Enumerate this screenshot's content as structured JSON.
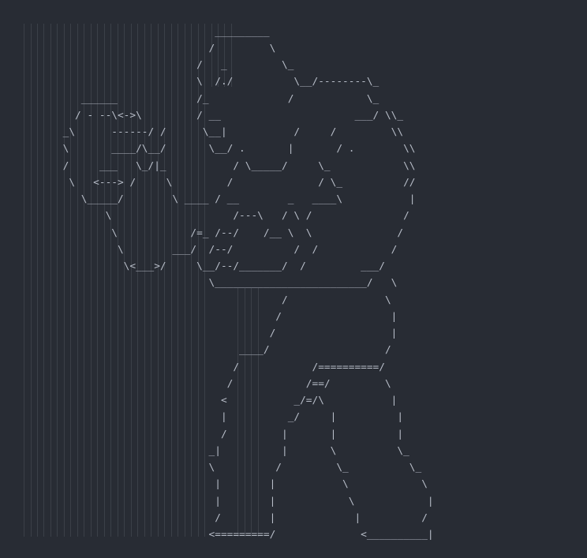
{
  "editor": {
    "line_numbers": [
      "1",
      "2",
      "3",
      "4",
      "5",
      "6",
      "7",
      "8",
      "9",
      "0",
      "1",
      "2",
      "3",
      "4",
      "5",
      "6",
      "7",
      "8",
      "9",
      "0",
      "1",
      "2",
      "3",
      "4",
      "5",
      "6",
      "7",
      "8",
      "9",
      "0",
      "1",
      "2",
      "3",
      "4"
    ],
    "lines": [
      "",
      "",
      "                                 _________",
      "                                /         \\",
      "                              /   _         \\_",
      "                              \\  /./          \\__/--------\\_",
      "           ______             /_             /            \\_",
      "          / - --\\<->\\         / __                      ___/ \\\\_",
      "        _\\      ------/ /      \\__|           /     /         \\\\",
      "        \\       ____/\\__/       \\__/ .       |       / .        \\\\",
      "        /     ___   \\_/|_           / \\_____/     \\_            \\\\",
      "         \\   <---> /     \\         /              / \\_          //",
      "           \\_____/        \\ ____ / __        _   ____\\           |",
      "               \\                    /---\\   / \\ /               /",
      "                \\            /=_ /--/    /__ \\  \\              /",
      "                 \\        ___/  /--/          /  /            /",
      "                  \\<___>/     \\__/--/_______/  /         ___/",
      "                                \\_________________________/   \\",
      "                                            /                \\",
      "                                           /                  |",
      "                                          /                   |",
      "                                     ____/                   /",
      "                                    /            /==========/",
      "                                   /            /==/         \\",
      "                                  <           _/=/\\           |",
      "                                  |          _/     |          |",
      "                                  /         |       |          |",
      "                                _|          |       \\          \\_",
      "                                \\          /         \\_          \\_",
      "                                 |        |           \\            \\",
      "                                 |        |            \\            |",
      "                                 /        |             |          /",
      "                                <=========/              <__________|",
      ""
    ]
  }
}
